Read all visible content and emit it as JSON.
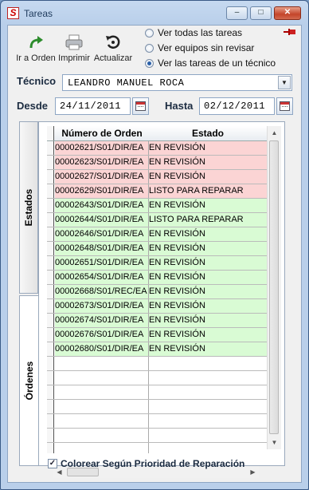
{
  "window": {
    "title": "Tareas",
    "minimize": "–",
    "maximize": "□",
    "close": "✕",
    "app_icon": "S"
  },
  "toolbar": {
    "ir_a_orden": "Ir a Orden",
    "imprimir": "Imprimir",
    "actualizar": "Actualizar"
  },
  "filter": {
    "options": [
      "Ver todas las tareas",
      "Ver equipos sin revisar",
      "Ver las tareas de un técnico"
    ],
    "selected": 2
  },
  "tecnico": {
    "label": "Técnico",
    "value": "LEANDRO MANUEL ROCA"
  },
  "desde": {
    "label": "Desde",
    "value": "24/11/2011"
  },
  "hasta": {
    "label": "Hasta",
    "value": "02/12/2011"
  },
  "tabs": [
    "Estados",
    "Órdenes"
  ],
  "grid": {
    "columns": [
      "Número de Orden",
      "Estado"
    ],
    "rows": [
      {
        "orden": "00002621/S01/DIR/EA",
        "estado": "EN REVISIÓN",
        "color": "red"
      },
      {
        "orden": "00002623/S01/DIR/EA",
        "estado": "EN REVISIÓN",
        "color": "red"
      },
      {
        "orden": "00002627/S01/DIR/EA",
        "estado": "EN REVISIÓN",
        "color": "red"
      },
      {
        "orden": "00002629/S01/DIR/EA",
        "estado": "LISTO PARA REPARAR",
        "color": "red"
      },
      {
        "orden": "00002643/S01/DIR/EA",
        "estado": "EN REVISIÓN",
        "color": "green"
      },
      {
        "orden": "00002644/S01/DIR/EA",
        "estado": "LISTO PARA REPARAR",
        "color": "green"
      },
      {
        "orden": "00002646/S01/DIR/EA",
        "estado": "EN REVISIÓN",
        "color": "green"
      },
      {
        "orden": "00002648/S01/DIR/EA",
        "estado": "EN REVISIÓN",
        "color": "green"
      },
      {
        "orden": "00002651/S01/DIR/EA",
        "estado": "EN REVISIÓN",
        "color": "green"
      },
      {
        "orden": "00002654/S01/DIR/EA",
        "estado": "EN REVISIÓN",
        "color": "green"
      },
      {
        "orden": "00002668/S01/REC/EA",
        "estado": "EN REVISIÓN",
        "color": "green"
      },
      {
        "orden": "00002673/S01/DIR/EA",
        "estado": "EN REVISIÓN",
        "color": "green"
      },
      {
        "orden": "00002674/S01/DIR/EA",
        "estado": "EN REVISIÓN",
        "color": "green"
      },
      {
        "orden": "00002676/S01/DIR/EA",
        "estado": "EN REVISIÓN",
        "color": "green"
      },
      {
        "orden": "00002680/S01/DIR/EA",
        "estado": "EN REVISIÓN",
        "color": "green"
      }
    ],
    "colors": {
      "red": "#fbd4d4",
      "green": "#d9fbd4",
      "white": "#ffffff"
    }
  },
  "colorear": {
    "label": "Colorear Según Prioridad de Reparación",
    "checked": true
  }
}
